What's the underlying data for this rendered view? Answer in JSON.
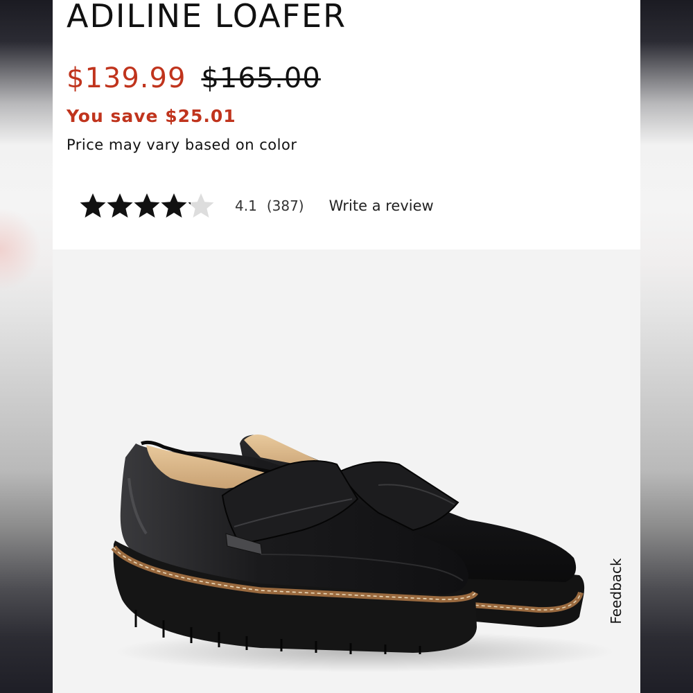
{
  "product": {
    "title": "ADILINE LOAFER",
    "sale_price": "$139.99",
    "original_price": "$165.00",
    "savings": "You save $25.01",
    "price_note": "Price may vary based on color"
  },
  "rating": {
    "stars_filled": 4.1,
    "stars_total": 5,
    "value": "4.1",
    "count": "(387)",
    "write_review": "Write a review",
    "star_color": "#111111",
    "empty_star_color": "#dddddd"
  },
  "colors": {
    "sale": "#c0341d",
    "text": "#111111",
    "image_bg": "#f3f3f3"
  },
  "image": {
    "subject": "black leather penny loafers with platform sole"
  },
  "feedback": {
    "label": "Feedback"
  }
}
